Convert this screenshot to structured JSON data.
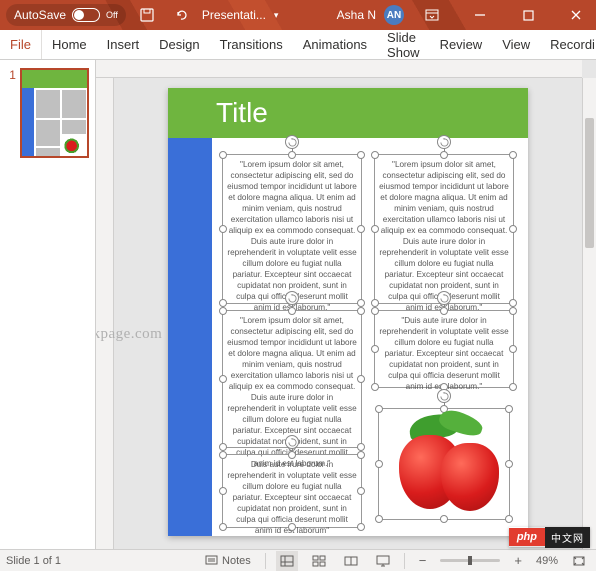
{
  "titlebar": {
    "autosave_label": "AutoSave",
    "autosave_state": "Off",
    "doc_title": "Presentati...",
    "user_name": "Asha N",
    "user_initials": "AN"
  },
  "ribbon": {
    "tabs": [
      "File",
      "Home",
      "Insert",
      "Design",
      "Transitions",
      "Animations",
      "Slide Show",
      "Review",
      "View",
      "Recordi"
    ]
  },
  "thumbnails": {
    "items": [
      {
        "index": "1"
      }
    ]
  },
  "slide": {
    "title": "Title",
    "lorem_long": "\"Lorem ipsum dolor sit amet, consectetur adipiscing elit, sed do eiusmod tempor incididunt ut labore et dolore magna aliqua. Ut enim ad minim veniam, quis nostrud exercitation ullamco laboris nisi ut aliquip ex ea commodo consequat. Duis aute irure dolor in reprehenderit in voluptate velit esse cillum dolore eu fugiat nulla pariatur. Excepteur sint occaecat cupidatat non proident, sunt in culpa qui officia deserunt mollit anim id est laborum.\"",
    "lorem_mid": "\"Lorem ipsum dolor sit amet, consectetur adipiscing elit, sed do eiusmod tempor incididunt ut labore et dolore magna aliqua. Ut enim ad minim veniam, quis nostrud exercitation ullamco laboris nisi ut aliquip ex ea commodo consequat. Duis aute irure dolor in reprehenderit in voluptate velit esse cillum dolore eu fugiat nulla pariatur. Excepteur sint occaecat cupidatat non proident, sunt in culpa qui officia deserunt mollit anim id est laborum.\"",
    "lorem_short": "\"Duis aute irure dolor in reprehenderit in voluptate velit esse cillum dolore eu fugiat nulla pariatur. Excepteur sint occaecat cupidatat non proident, sunt in culpa qui officia deserunt mollit anim id est laborum.\"",
    "lorem_shorter": "Duis aute irure dolor in reprehenderit in voluptate velit esse cillum dolore eu fugiat nulla pariatur. Excepteur sint occaecat cupidatat non proident, sunt in culpa qui officia deserunt mollit anim id est laborum\""
  },
  "watermark": "@thegeekpage.com",
  "statusbar": {
    "slide_info": "Slide 1 of 1",
    "notes_label": "Notes",
    "zoom_value": "49%"
  },
  "badge": {
    "php": "php",
    "cn": "中文网"
  },
  "colors": {
    "brand": "#b7472a",
    "slide_title_bg": "#6fb53f",
    "slide_side_bg": "#3a6fd8"
  }
}
